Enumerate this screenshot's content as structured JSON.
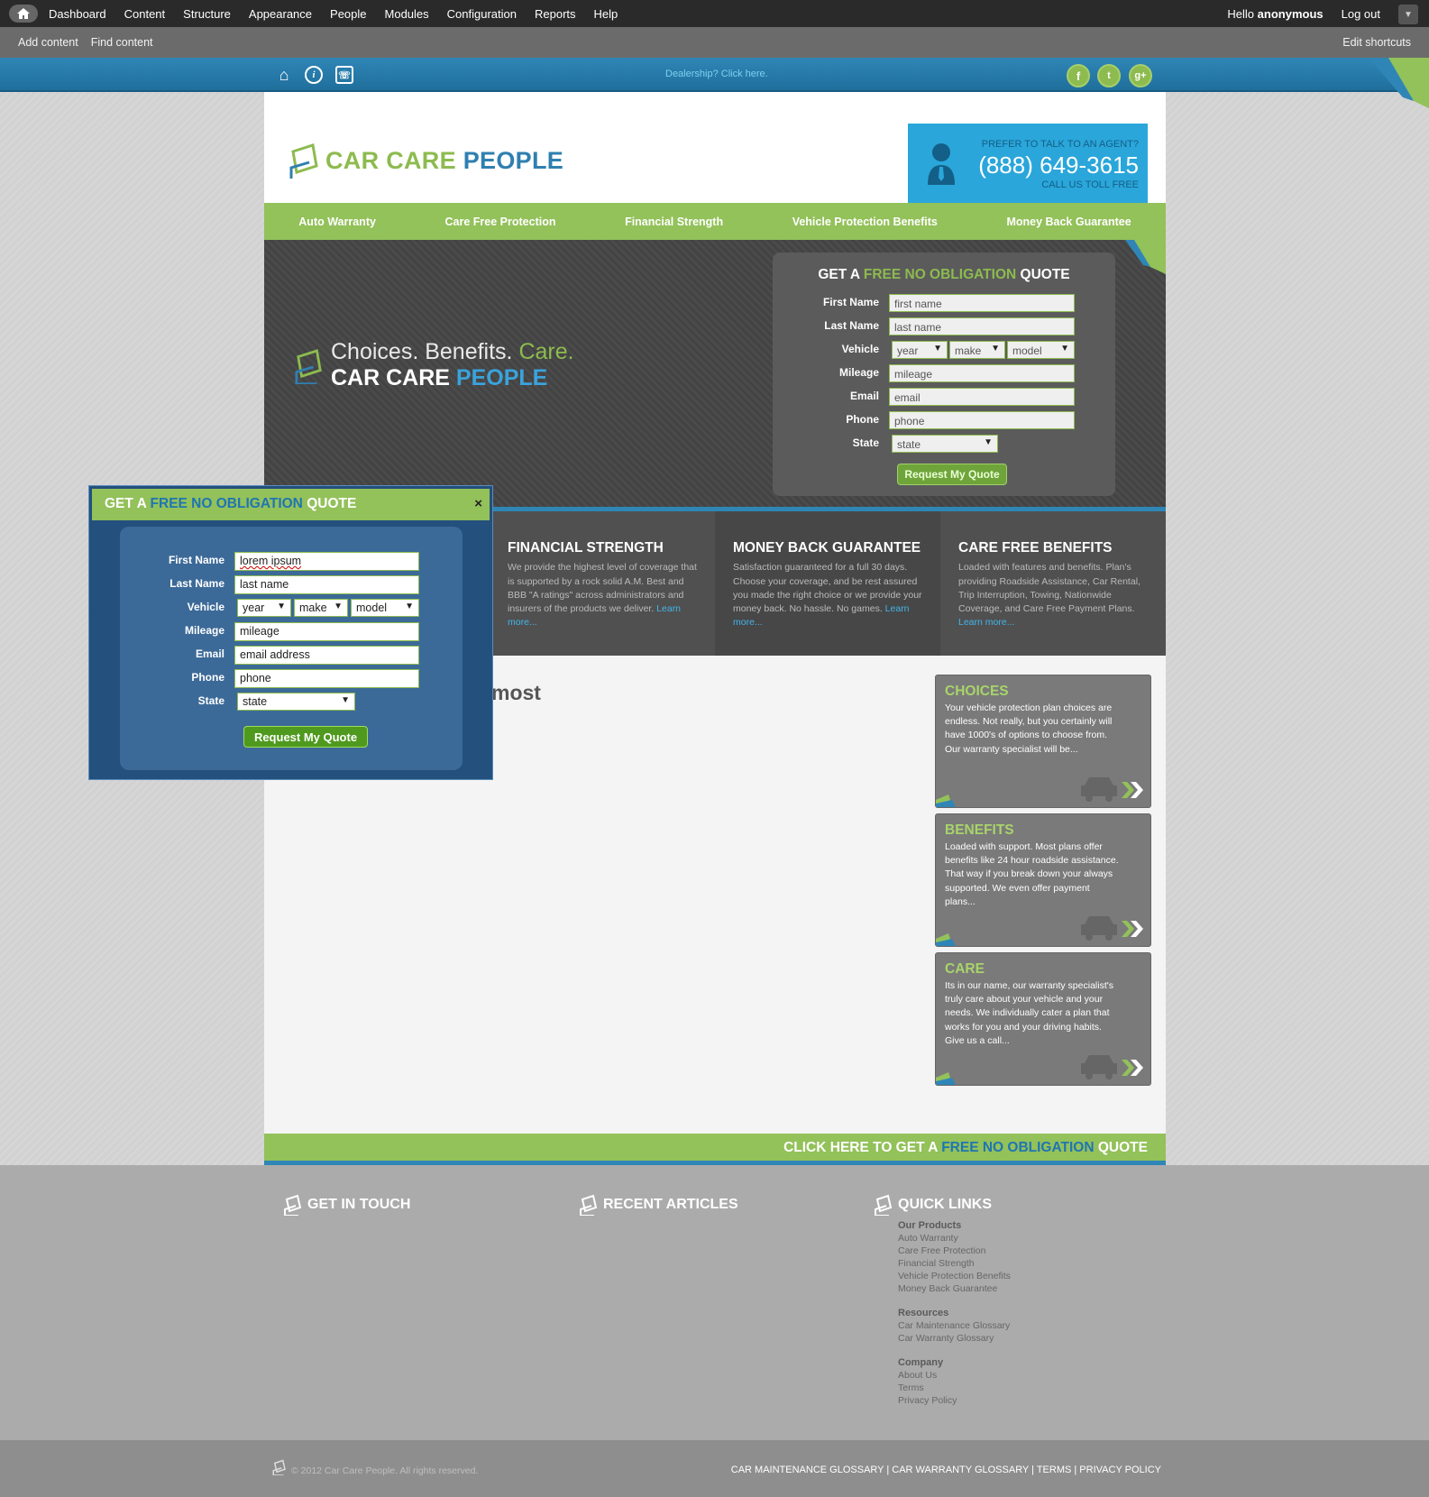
{
  "toolbar": {
    "items": [
      "Dashboard",
      "Content",
      "Structure",
      "Appearance",
      "People",
      "Modules",
      "Configuration",
      "Reports",
      "Help"
    ],
    "hello": "Hello",
    "user": "anonymous",
    "logout": "Log out"
  },
  "shortcuts": {
    "add": "Add content",
    "find": "Find content",
    "edit": "Edit shortcuts"
  },
  "topbar": {
    "dealer": "Dealership? Click here.",
    "icons": [
      "home-icon",
      "info-icon",
      "phone-icon"
    ],
    "social": [
      "facebook-icon",
      "twitter-icon",
      "google-plus-icon"
    ]
  },
  "header": {
    "logo_a": "CAR CARE",
    "logo_b": "PEOPLE",
    "agent_q": "PREFER TO TALK TO AN AGENT?",
    "phone": "(888) 649-3615",
    "agent_call": "CALL US TOLL FREE"
  },
  "nav": [
    "Auto Warranty",
    "Care Free Protection",
    "Financial Strength",
    "Vehicle Protection Benefits",
    "Money Back Guarantee"
  ],
  "hero": {
    "tag_a": "Choices. Benefits.",
    "tag_b": "Care.",
    "brand_a": "CAR CARE",
    "brand_b": "PEOPLE"
  },
  "quote_form": {
    "title_a": "GET A",
    "title_b": "FREE NO OBLIGATION",
    "title_c": "QUOTE",
    "labels": {
      "first": "First Name",
      "last": "Last Name",
      "vehicle": "Vehicle",
      "mileage": "Mileage",
      "email": "Email",
      "phone": "Phone",
      "state": "State"
    },
    "placeholders": {
      "first": "first name",
      "last": "last name",
      "year": "year",
      "make": "make",
      "model": "model",
      "mileage": "mileage",
      "email": "email",
      "phone": "phone",
      "state": "state"
    },
    "button": "Request My Quote"
  },
  "features": [
    {
      "title": "FINANCIAL STRENGTH",
      "text": "We provide the highest level of coverage that is supported by a rock solid A.M. Best and BBB \"A ratings\" across administrators and insurers of the products we deliver.",
      "link": "Learn more..."
    },
    {
      "title": "MONEY BACK GUARANTEE",
      "text": "Satisfaction guaranteed for a full 30 days. Choose your coverage, and be rest assured you made the right choice or we provide your money back. No hassle. No games.",
      "link": "Learn more..."
    },
    {
      "title": "CARE FREE BENEFITS",
      "text": "Loaded with features and benefits. Plan's providing Roadside Assistance, Car Rental, Trip Interruption, Towing, Nationwide Coverage, and Care Free Payment Plans.",
      "link": "Learn more..."
    }
  ],
  "content": {
    "heading_fragment": "most"
  },
  "cards": [
    {
      "title": "CHOICES",
      "text": "Your vehicle protection plan choices are endless. Not really, but you certainly will have 1000's of options to choose from. Our warranty specialist will be..."
    },
    {
      "title": "BENEFITS",
      "text": "Loaded with support. Most plans offer benefits like 24 hour roadside assistance. That way if you break down your always supported. We even offer payment plans..."
    },
    {
      "title": "CARE",
      "text": "Its in our name, our warranty specialist's truly care about your vehicle and your needs. We individually cater a plan that works for you and your driving habits. Give us a call..."
    }
  ],
  "cta": {
    "a": "CLICK HERE TO GET A",
    "b": "FREE NO OBLIGATION",
    "c": "QUOTE"
  },
  "footer": {
    "cols": [
      "GET IN TOUCH",
      "RECENT ARTICLES",
      "QUICK LINKS"
    ],
    "products_h": "Our Products",
    "products": [
      "Auto Warranty",
      "Care Free Protection",
      "Financial Strength",
      "Vehicle Protection Benefits",
      "Money Back Guarantee"
    ],
    "resources_h": "Resources",
    "resources": [
      "Car Maintenance Glossary",
      "Car Warranty Glossary"
    ],
    "company_h": "Company",
    "company": [
      "About Us",
      "Terms",
      "Privacy Policy"
    ],
    "copyright": "© 2012 Car Care People. All rights reserved.",
    "bottom_links": "CAR MAINTENANCE GLOSSARY | CAR WARRANTY GLOSSARY | TERMS | PRIVACY POLICY"
  },
  "popup": {
    "title_a": "GET A",
    "title_b": "FREE NO OBLIGATION",
    "title_c": "QUOTE",
    "close": "×",
    "labels": {
      "first": "First Name",
      "last": "Last Name",
      "vehicle": "Vehicle",
      "mileage": "Mileage",
      "email": "Email",
      "phone": "Phone",
      "state": "State"
    },
    "values": {
      "first": "lorem ipsum",
      "last": "last name",
      "year": "year",
      "make": "make",
      "model": "model",
      "mileage": "mileage",
      "email": "email address",
      "phone": "phone",
      "state": "state"
    },
    "button": "Request My Quote"
  },
  "colors": {
    "green": "#93c15a",
    "blue": "#2f86b6",
    "dark": "#454545"
  }
}
